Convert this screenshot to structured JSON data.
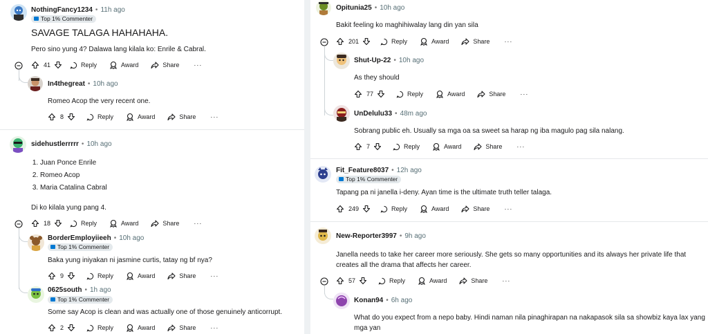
{
  "badge_label": "Top 1% Commenter",
  "actions": {
    "reply": "Reply",
    "award": "Award",
    "share": "Share",
    "more": "···"
  },
  "colors": {
    "badge_bg": "#e4e9ec",
    "badge_icon": "#0079d3",
    "thread_line": "#cdd3d7"
  },
  "left": {
    "comments": [
      {
        "author": "NothingFancy1234",
        "time": "11h ago",
        "title": "SAVAGE TALAGA HAHAHAHA.",
        "body": "Pero sino yung 4? Dalawa lang kilala ko: Enrile & Cabral.",
        "score": "41",
        "avatar_icon": "avatar-icon"
      },
      {
        "author": "In4thegreat",
        "time": "10h ago",
        "body": "Romeo Acop the very recent one.",
        "score": "8",
        "avatar_icon": "avatar-icon"
      },
      {
        "author": "sidehustlerrrrr",
        "time": "10h ago",
        "list": [
          "Juan Ponce Enrile",
          "Romeo Acop",
          "Maria Catalina Cabral"
        ],
        "body": "Di ko kilala yung pang 4.",
        "score": "18",
        "avatar_icon": "avatar-icon"
      },
      {
        "author": "BorderEmployiieeh",
        "time": "10h ago",
        "body": "Baka yung iniyakan ni jasmine curtis, tatay ng bf nya?",
        "score": "9",
        "avatar_icon": "avatar-icon"
      },
      {
        "author": "0625south",
        "time": "1h ago",
        "body": "Some say Acop is clean and was actually one of those genuinely anticorrupt.",
        "score": "2",
        "avatar_icon": "avatar-icon"
      }
    ]
  },
  "right": {
    "comments": [
      {
        "author": "Opitunia25",
        "time": "10h ago",
        "body": "Bakit feeling ko maghihiwalay lang din yan sila",
        "score": "201",
        "avatar_icon": "avatar-icon"
      },
      {
        "author": "Shut-Up-22",
        "time": "10h ago",
        "body": "As they should",
        "score": "77",
        "avatar_icon": "avatar-icon"
      },
      {
        "author": "UnDelulu33",
        "time": "48m ago",
        "body": "Sobrang public eh. Usually sa mga oa sa sweet sa harap ng iba magulo pag sila nalang.",
        "score": "7",
        "avatar_icon": "avatar-icon"
      },
      {
        "author": "Fit_Feature8037",
        "time": "12h ago",
        "body": "Tapang pa ni janella i-deny. Ayan time is the ultimate truth teller talaga.",
        "score": "249",
        "avatar_icon": "avatar-icon"
      },
      {
        "author": "New-Reporter3997",
        "time": "9h ago",
        "body": "Janella needs to take her career more seriously. She gets so many opportunities and its always her private life that creates all the drama that affects her career.",
        "score": "57",
        "avatar_icon": "avatar-icon"
      },
      {
        "author": "Konan94",
        "time": "6h ago",
        "body": "What do you expect from a nepo baby. Hindi naman nila pinaghirapan na nakapasok sila sa showbiz kaya lax yang mga yan",
        "avatar_icon": "avatar-icon"
      }
    ]
  }
}
